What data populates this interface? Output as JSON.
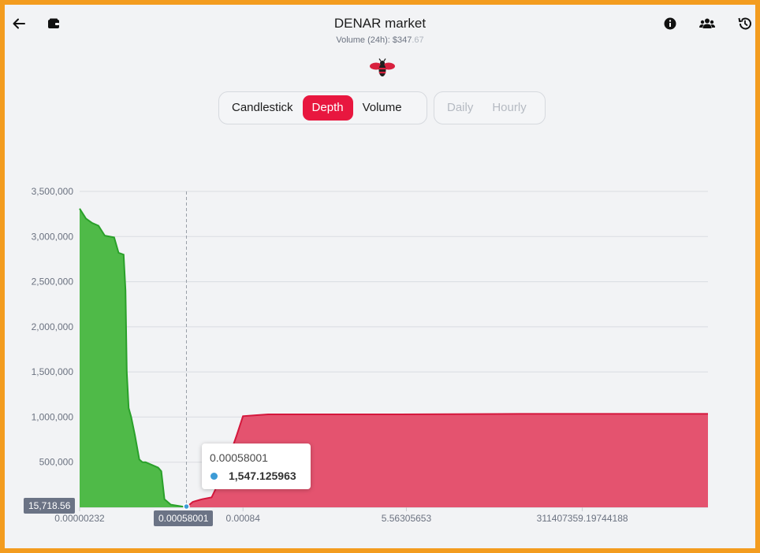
{
  "header": {
    "title": "DENAR market",
    "volume_label": "Volume (24h): $347",
    "volume_fraction": ".67",
    "back_icon": "arrow-left-icon",
    "wallet_icon": "wallet-icon",
    "info_icon": "info-circle-icon",
    "users_icon": "users-icon",
    "history_icon": "history-icon"
  },
  "chart_tabs": [
    {
      "label": "Candlestick",
      "active": false
    },
    {
      "label": "Depth",
      "active": true
    },
    {
      "label": "Volume",
      "active": false
    }
  ],
  "interval_tabs": [
    {
      "label": "Daily",
      "disabled": true
    },
    {
      "label": "Hourly",
      "disabled": true
    }
  ],
  "colors": {
    "accent": "#e8173f",
    "bid_fill": "#4fba48",
    "bid_line": "#2aa02a",
    "ask_fill": "#e4536f",
    "ask_line": "#d4173c",
    "frame": "#f39c1f"
  },
  "chart_data": {
    "type": "area",
    "y_ticks": [
      "3,500,000",
      "3,000,000",
      "2,500,000",
      "2,000,000",
      "1,500,000",
      "1,000,000",
      "500,000"
    ],
    "ylim": [
      0,
      3500000
    ],
    "x_ticks": [
      "0.00000232",
      "0.00084",
      "5.56305653",
      "311407359.19744188"
    ],
    "series": [
      {
        "name": "",
        "color": "#4fba48",
        "points": [
          [
            0.0,
            3310000
          ],
          [
            0.01,
            3200000
          ],
          [
            0.02,
            3150000
          ],
          [
            0.03,
            3120000
          ],
          [
            0.04,
            3010000
          ],
          [
            0.055,
            2990000
          ],
          [
            0.062,
            2820000
          ],
          [
            0.07,
            2800000
          ],
          [
            0.073,
            2400000
          ],
          [
            0.075,
            1500000
          ],
          [
            0.078,
            1100000
          ],
          [
            0.082,
            1000000
          ],
          [
            0.088,
            800000
          ],
          [
            0.095,
            530000
          ],
          [
            0.1,
            500000
          ],
          [
            0.105,
            500000
          ],
          [
            0.115,
            470000
          ],
          [
            0.125,
            440000
          ],
          [
            0.13,
            400000
          ],
          [
            0.135,
            90000
          ],
          [
            0.145,
            30000
          ],
          [
            0.17,
            1547
          ]
        ]
      },
      {
        "name": "",
        "color": "#e4536f",
        "points": [
          [
            0.17,
            1547
          ],
          [
            0.18,
            60000
          ],
          [
            0.195,
            90000
          ],
          [
            0.21,
            110000
          ],
          [
            0.23,
            400000
          ],
          [
            0.25,
            800000
          ],
          [
            0.26,
            1010000
          ],
          [
            0.28,
            1020000
          ],
          [
            0.3,
            1030000
          ],
          [
            0.5,
            1030000
          ],
          [
            0.7,
            1035000
          ],
          [
            1.0,
            1035000
          ]
        ]
      }
    ],
    "crosshair": {
      "x": 0.17,
      "x_label": "0.00058001",
      "y_label": "15,718.56"
    },
    "tooltip": {
      "x": "0.00058001",
      "y": "1,547.125963"
    },
    "grid": true
  }
}
